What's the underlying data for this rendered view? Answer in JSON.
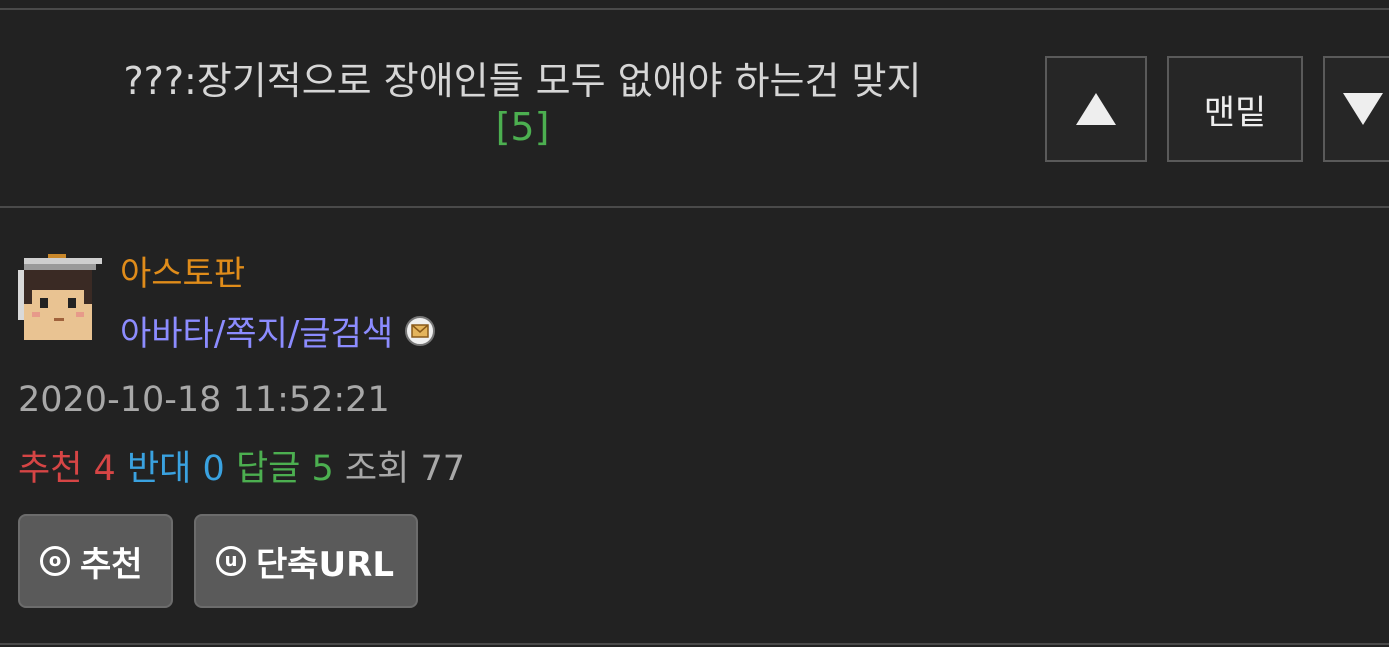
{
  "post": {
    "title": "???:장기적으로 장애인들 모두 없애야 하는건 맞지",
    "comment_count": "[5]"
  },
  "nav": {
    "up_icon": "triangle-up-icon",
    "bottom_label": "맨밑",
    "down_icon": "triangle-down-icon"
  },
  "author": {
    "nickname": "아스토판",
    "links": "아바타/쪽지/글검색",
    "mail_icon": "envelope-icon"
  },
  "meta": {
    "date": "2020-10-18 11:52:21",
    "recommend_label": "추천",
    "recommend_value": "4",
    "oppose_label": "반대",
    "oppose_value": "0",
    "reply_label": "답글",
    "reply_value": "5",
    "views_label": "조회",
    "views_value": "77"
  },
  "actions": {
    "recommend_symbol": "o",
    "recommend_label": "추천",
    "shorturl_symbol": "u",
    "shorturl_label": "단축URL"
  },
  "colors": {
    "background": "#222222",
    "nickname": "#e08c1a",
    "link": "#8c8cff",
    "recommend": "#d64545",
    "oppose": "#3aa2e0",
    "reply": "#4caf50"
  }
}
